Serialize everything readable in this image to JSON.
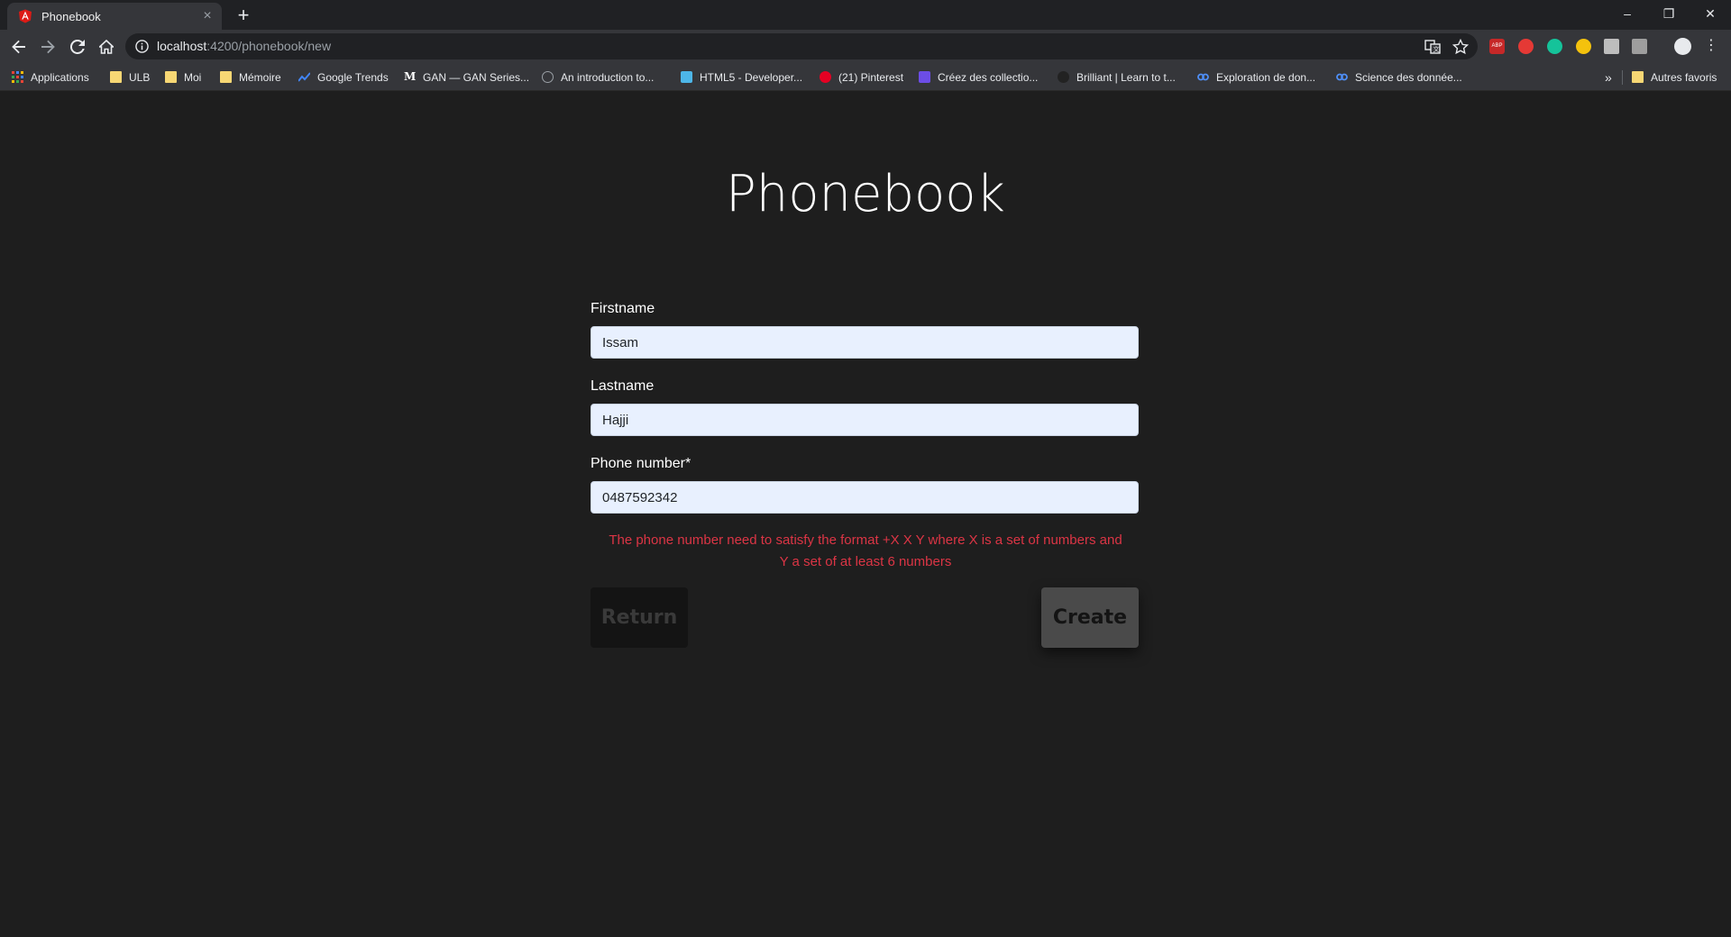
{
  "browser": {
    "tab_title": "Phonebook",
    "tab_close": "×",
    "new_tab": "+",
    "url_host": "localhost",
    "url_path": ":4200/phonebook/new",
    "window_controls": {
      "minimize": "–",
      "restore": "❐",
      "close": "✕"
    }
  },
  "bookmarks": {
    "items": [
      {
        "label": "Applications",
        "icon": "apps-grid-icon"
      },
      {
        "label": "ULB",
        "icon": "folder-icon"
      },
      {
        "label": "Moi",
        "icon": "folder-icon"
      },
      {
        "label": "Mémoire",
        "icon": "folder-icon"
      },
      {
        "label": "Google Trends",
        "icon": "trends-icon"
      },
      {
        "label": "GAN — GAN Series...",
        "icon": "medium-icon"
      },
      {
        "label": "An introduction to...",
        "icon": "site-icon"
      },
      {
        "label": "HTML5 - Developer...",
        "icon": "html5-icon"
      },
      {
        "label": "(21) Pinterest",
        "icon": "pinterest-icon"
      },
      {
        "label": "Créez des collectio...",
        "icon": "site-icon"
      },
      {
        "label": "Brilliant | Learn to t...",
        "icon": "brilliant-icon"
      },
      {
        "label": "Exploration de don...",
        "icon": "coursera-icon"
      },
      {
        "label": "Science des donnée...",
        "icon": "coursera-icon"
      }
    ],
    "overflow": "»",
    "other": "Autres favoris"
  },
  "page": {
    "title": "Phonebook",
    "firstname": {
      "label": "Firstname",
      "value": "Issam"
    },
    "lastname": {
      "label": "Lastname",
      "value": "Hajji"
    },
    "phone": {
      "label": "Phone number*",
      "value": "0487592342"
    },
    "error_line1": "The phone number need to satisfy the format +X X Y where X is a set of numbers and",
    "error_line2": "Y a set of at least 6 numbers",
    "return_label": "Return",
    "create_label": "Create"
  },
  "colors": {
    "background": "#1e1e1e",
    "input_bg": "#e8f0fe",
    "error": "#dc3545",
    "create_button": "#4a4a4a",
    "return_button": "#141414"
  }
}
